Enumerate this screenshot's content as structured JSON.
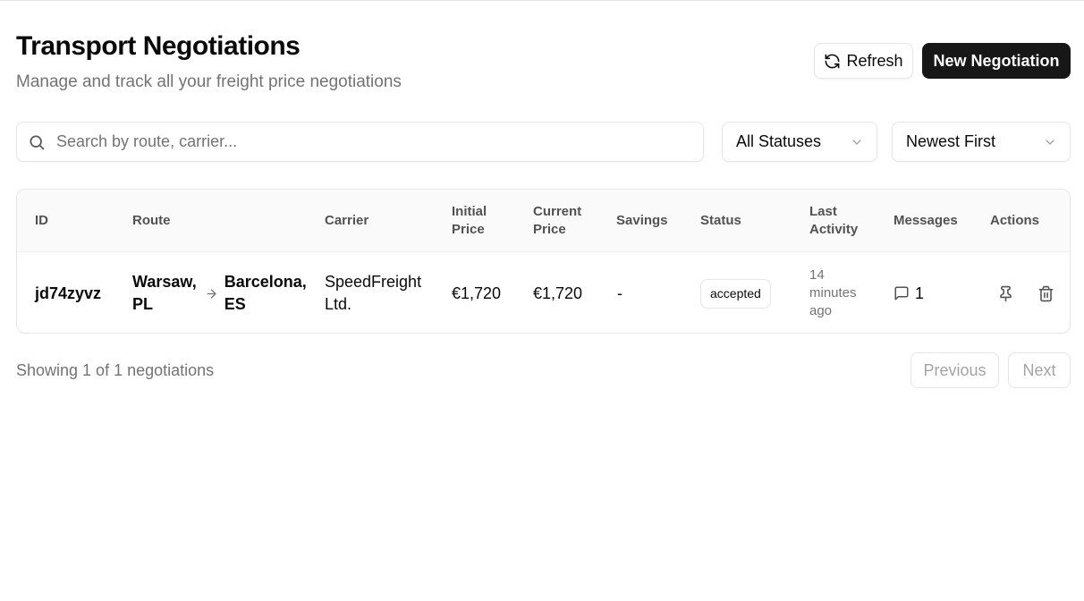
{
  "header": {
    "title": "Transport Negotiations",
    "subtitle": "Manage and track all your freight price negotiations",
    "refresh_label": "Refresh",
    "new_label": "New Negotiation"
  },
  "filters": {
    "search_placeholder": "Search by route, carrier...",
    "search_value": "",
    "status_selected": "All Statuses",
    "sort_selected": "Newest First"
  },
  "table": {
    "columns": {
      "id": "ID",
      "route": "Route",
      "carrier": "Carrier",
      "initial_price_1": "Initial",
      "initial_price_2": "Price",
      "current_price_1": "Current",
      "current_price_2": "Price",
      "savings": "Savings",
      "status": "Status",
      "last_activity_1": "Last",
      "last_activity_2": "Activity",
      "messages": "Messages",
      "actions": "Actions"
    },
    "rows": [
      {
        "id": "jd74zyvz",
        "origin_city": "Warsaw,",
        "origin_country": "PL",
        "destination_city": "Barcelona,",
        "destination_country": "ES",
        "carrier_1": "SpeedFreight",
        "carrier_2": "Ltd.",
        "initial_price": "€1,720",
        "current_price": "€1,720",
        "savings": "-",
        "status": "accepted",
        "last_activity_1": "14",
        "last_activity_2": "minutes",
        "last_activity_3": "ago",
        "messages": "1"
      }
    ]
  },
  "footer": {
    "showing": "Showing 1 of 1 negotiations",
    "previous_label": "Previous",
    "next_label": "Next"
  },
  "icons": {
    "refresh": "refresh-icon",
    "search": "search-icon",
    "chevron": "chevron-down-icon",
    "arrow": "arrow-right-icon",
    "message": "message-icon",
    "pin": "pin-icon",
    "trash": "trash-icon"
  },
  "colors": {
    "primary": "#171717",
    "muted_text": "#737373",
    "border": "#e5e5e5",
    "header_bg": "#fafafa"
  }
}
